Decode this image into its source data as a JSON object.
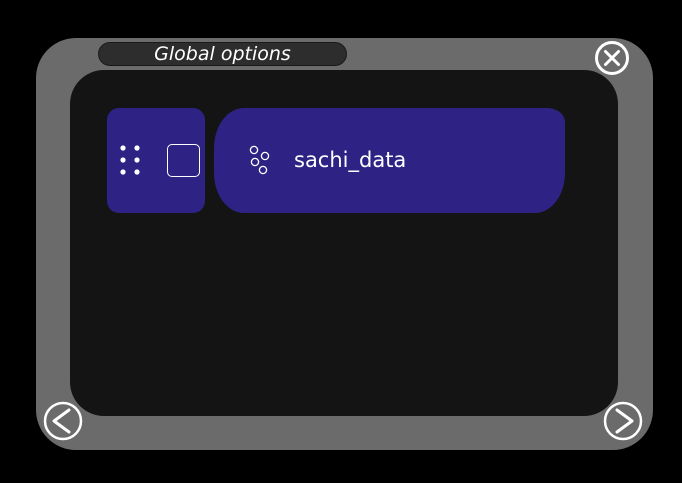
{
  "window": {
    "title": "Global options"
  },
  "icons": {
    "close": "close-icon",
    "drag_handle": "drag-handle-icon",
    "item": "bubbles-icon",
    "prev": "chevron-left-icon",
    "next": "chevron-right-icon"
  },
  "list": {
    "items": [
      {
        "label": "sachi_data",
        "checked": false
      }
    ]
  },
  "colors": {
    "background": "#000000",
    "frame": "#6b6b6b",
    "panel": "#141414",
    "title_pill": "#2d2d2d",
    "card": "#2e2385",
    "foreground": "#ffffff"
  }
}
